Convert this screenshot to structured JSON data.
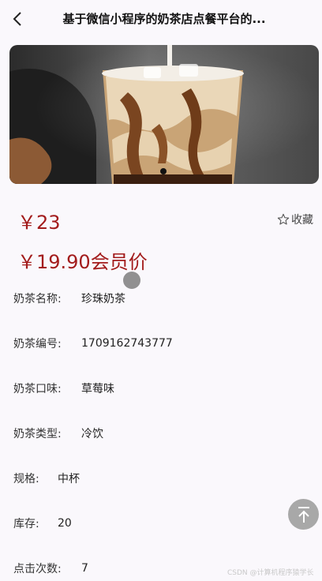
{
  "header": {
    "title": "基于微信小程序的奶茶店点餐平台的..."
  },
  "banner": {
    "image_alt": "",
    "dot_count": 1
  },
  "product": {
    "price": "￥23",
    "member_price": "￥19.90会员价",
    "collect_label": "收藏"
  },
  "details": [
    {
      "label": "奶茶名称:",
      "value": "珍珠奶茶"
    },
    {
      "label": "奶茶编号:",
      "value": "1709162743777"
    },
    {
      "label": "奶茶口味:",
      "value": "草莓味"
    },
    {
      "label": "奶茶类型:",
      "value": "冷饮"
    },
    {
      "label": "规格:",
      "value": "中杯"
    },
    {
      "label": "库存:",
      "value": "20"
    },
    {
      "label": "点击次数:",
      "value": "7"
    }
  ],
  "watermark": "CSDN @计算机程序猿学长",
  "colors": {
    "price": "#a31c1c",
    "background": "#faf8fc",
    "to_top_button": "#a8a8a8"
  }
}
